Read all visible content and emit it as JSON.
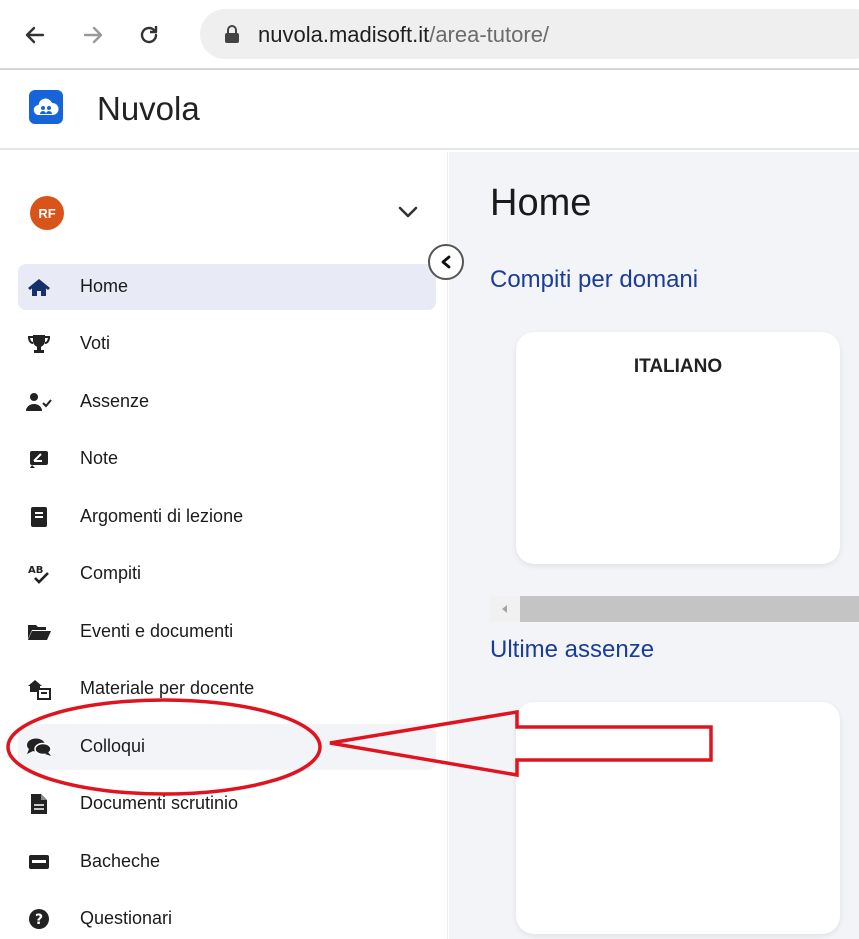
{
  "browser": {
    "url_host": "nuvola.madisoft.it",
    "url_path": "/area-tutore/",
    "back_icon": "back-arrow-icon",
    "forward_icon": "forward-arrow-icon",
    "reload_icon": "reload-icon",
    "lock_icon": "lock-icon"
  },
  "app": {
    "title": "Nuvola",
    "logo_icon": "cloud-logo-icon",
    "accent_color": "#1664d9"
  },
  "user": {
    "initials": "RF",
    "avatar_color": "#d9541a"
  },
  "sidebar": {
    "items": [
      {
        "label": "Home",
        "icon": "home-icon",
        "active": true
      },
      {
        "label": "Voti",
        "icon": "trophy-icon"
      },
      {
        "label": "Assenze",
        "icon": "user-check-icon"
      },
      {
        "label": "Note",
        "icon": "note-icon"
      },
      {
        "label": "Argomenti di lezione",
        "icon": "book-icon"
      },
      {
        "label": "Compiti",
        "icon": "spellcheck-icon"
      },
      {
        "label": "Eventi e documenti",
        "icon": "folder-open-icon"
      },
      {
        "label": "Materiale per docente",
        "icon": "house-share-icon"
      },
      {
        "label": "Colloqui",
        "icon": "comments-icon",
        "highlighted": true
      },
      {
        "label": "Documenti scrutinio",
        "icon": "file-icon"
      },
      {
        "label": "Bacheche",
        "icon": "board-icon"
      },
      {
        "label": "Questionari",
        "icon": "question-circle-icon"
      }
    ]
  },
  "main": {
    "page_title": "Home",
    "sections": [
      {
        "title": "Compiti per domani",
        "card_title": "ITALIANO"
      },
      {
        "title": "Ultime assenze",
        "card_title": ""
      }
    ]
  },
  "annotation": {
    "color": "#e0141e",
    "target": "Colloqui"
  }
}
